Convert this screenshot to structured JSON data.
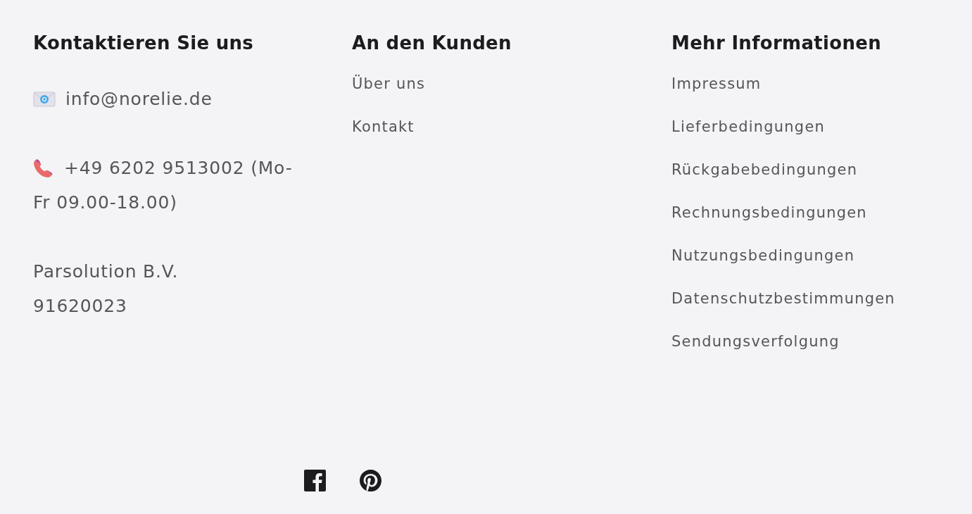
{
  "columns": [
    {
      "heading": "Kontaktieren Sie uns",
      "kind": "contact",
      "email": "info@norelie.de",
      "phone_lines": [
        "+49 6202 9513002 (Mo-",
        "Fr 09.00-18.00)"
      ],
      "company_lines": [
        "Parsolution B.V.",
        "91620023"
      ]
    },
    {
      "heading": "An den Kunden",
      "kind": "links",
      "links": [
        "Über uns",
        "Kontakt"
      ]
    },
    {
      "heading": "Mehr Informationen",
      "kind": "links",
      "links": [
        "Impressum",
        "Lieferbedingungen",
        "Rückgabebedingungen",
        "Rechnungsbedingungen",
        "Nutzungsbedingungen",
        "Datenschutzbestimmungen",
        "Sendungsverfolgung"
      ]
    }
  ],
  "social": [
    {
      "kind": "facebook"
    },
    {
      "kind": "pinterest"
    }
  ]
}
